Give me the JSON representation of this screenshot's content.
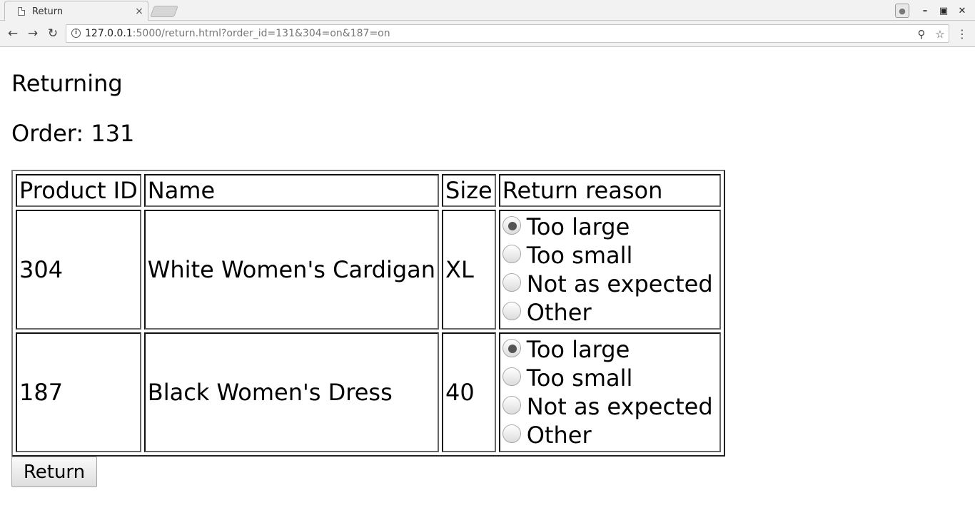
{
  "browser": {
    "tab_title": "Return",
    "tab_close": "×",
    "url_host": "127.0.0.1",
    "url_rest": ":5000/return.html?order_id=131&304=on&187=on"
  },
  "page": {
    "heading": "Returning",
    "order_line": "Order: 131",
    "table": {
      "headers": [
        "Product ID",
        "Name",
        "Size",
        "Return reason"
      ],
      "rows": [
        {
          "product_id": "304",
          "name": "White Women's Cardigan",
          "size": "XL",
          "reasons": [
            "Too large",
            "Too small",
            "Not as expected",
            "Other"
          ],
          "selected_reason": "Too large"
        },
        {
          "product_id": "187",
          "name": "Black Women's Dress",
          "size": "40",
          "reasons": [
            "Too large",
            "Too small",
            "Not as expected",
            "Other"
          ],
          "selected_reason": "Too large"
        }
      ]
    },
    "submit_label": "Return"
  },
  "icons": {
    "tab": "document-icon",
    "back": "back-arrow-icon",
    "forward": "forward-arrow-icon",
    "reload": "reload-icon",
    "info": "info-icon",
    "zoom": "zoom-icon",
    "bookmark": "star-icon",
    "menu": "kebab-menu-icon"
  }
}
